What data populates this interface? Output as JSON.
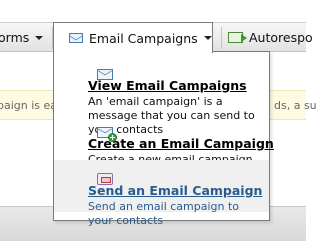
{
  "nav": {
    "forms_label": "orms",
    "email_label": "Email Campaigns",
    "autoresponders_label": "Autorespo"
  },
  "notice": {
    "left_text": "paign is eas",
    "right_text": "ds, a su"
  },
  "dropdown": {
    "items": [
      {
        "title": "View Email Campaigns",
        "description": "An 'email campaign' is a message that you can send to your contacts",
        "icon": "envelope-icon"
      },
      {
        "title": "Create an Email Campaign",
        "description": "Create a new email campaign",
        "icon": "envelope-add-icon"
      },
      {
        "title": "Send an Email Campaign",
        "description": "Send an email campaign to your contacts",
        "icon": "send-envelope-icon"
      }
    ]
  },
  "colors": {
    "highlight_text": "#2a5c8f",
    "notice_background": "#fefbe2"
  }
}
